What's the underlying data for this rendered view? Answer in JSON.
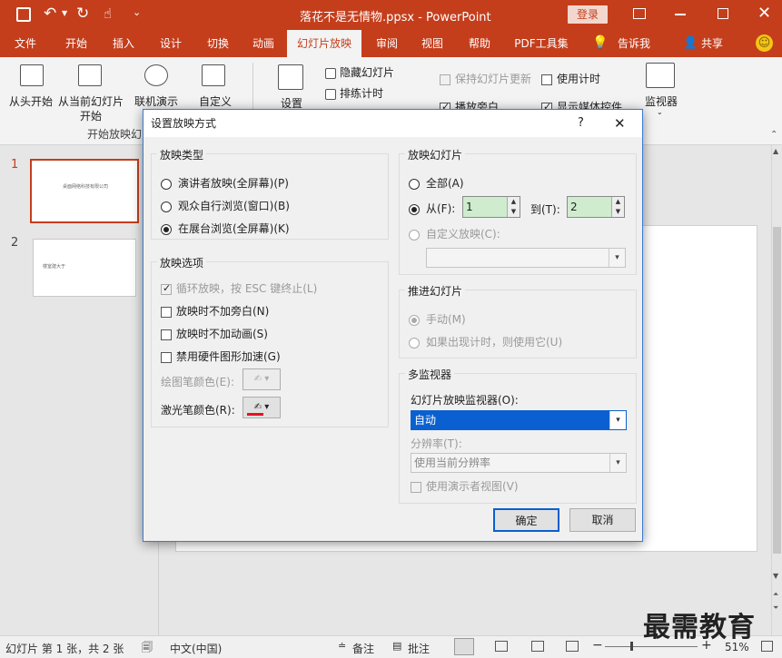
{
  "window": {
    "title": "落花不是无情物.ppsx  -  PowerPoint",
    "login_label": "登录",
    "quick_access": {
      "save": "save-icon",
      "undo": "undo-icon",
      "redo": "redo-icon",
      "touch": "touch-mode-icon",
      "customize": "customize-qat-icon"
    }
  },
  "tabs": [
    "文件",
    "开始",
    "插入",
    "设计",
    "切换",
    "动画",
    "幻灯片放映",
    "审阅",
    "视图",
    "帮助",
    "PDF工具集",
    "告诉我",
    "共享"
  ],
  "ribbon": {
    "from_start": "从头开始",
    "from_current_1": "从当前幻灯片",
    "from_current_2": "开始",
    "online": "联机演示",
    "custom": "自定义",
    "group_start": "开始放映幻",
    "setup": "设置",
    "hide_slide": "隐藏幻灯片",
    "rehearse": "排练计时",
    "keep_updated": "保持幻灯片更新",
    "use_timings": "使用计时",
    "play_narration": "播放旁白",
    "show_media": "显示媒体控件",
    "monitor": "监视器"
  },
  "slides": [
    {
      "number": "1",
      "thumb_text": "桌面网络科技有限公司"
    },
    {
      "number": "2",
      "thumb_text": "楼室建大于"
    }
  ],
  "dialog": {
    "title": "设置放映方式",
    "help": "?",
    "show_type": {
      "title": "放映类型",
      "options": [
        "演讲者放映(全屏幕)(P)",
        "观众自行浏览(窗口)(B)",
        "在展台浏览(全屏幕)(K)"
      ],
      "selected": 2
    },
    "show_options": {
      "title": "放映选项",
      "loop": "循环放映，按 ESC 键终止(L)",
      "no_narration": "放映时不加旁白(N)",
      "no_animation": "放映时不加动画(S)",
      "no_hw_accel": "禁用硬件图形加速(G)",
      "pen_color": "绘图笔颜色(E):",
      "laser_color": "激光笔颜色(R):",
      "laser_color_value": "#e81123"
    },
    "show_slides": {
      "title": "放映幻灯片",
      "all": "全部(A)",
      "from": "从(F):",
      "from_value": "1",
      "to": "到(T):",
      "to_value": "2",
      "custom": "自定义放映(C):"
    },
    "advance": {
      "title": "推进幻灯片",
      "manual": "手动(M)",
      "timings": "如果出现计时，则使用它(U)"
    },
    "monitors": {
      "title": "多监视器",
      "monitor_label": "幻灯片放映监视器(O):",
      "monitor_value": "自动",
      "resolution_label": "分辨率(T):",
      "resolution_value": "使用当前分辨率",
      "presenter_view": "使用演示者视图(V)"
    },
    "ok": "确定",
    "cancel": "取消"
  },
  "status": {
    "slide_info": "幻灯片 第 1 张，共 2 张",
    "language": "中文(中国)",
    "notes": "备注",
    "comments": "批注",
    "zoom": "51%"
  },
  "watermark": "最需教育",
  "colors": {
    "accent": "#c43e1c",
    "dialog_border": "#3a7bd5",
    "selected": "#0a60d0"
  }
}
